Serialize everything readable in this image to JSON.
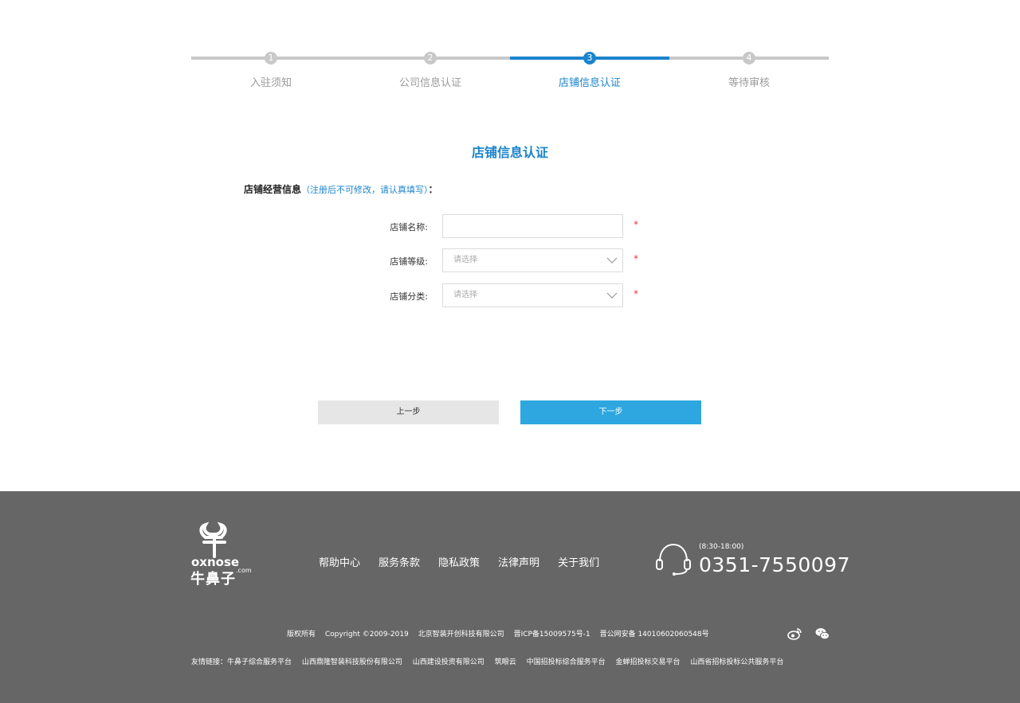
{
  "stepper": {
    "steps": [
      {
        "num": "1",
        "label": "入驻须知"
      },
      {
        "num": "2",
        "label": "公司信息认证"
      },
      {
        "num": "3",
        "label": "店铺信息认证"
      },
      {
        "num": "4",
        "label": "等待审核"
      }
    ],
    "active_step": 3
  },
  "form": {
    "title": "店铺信息认证",
    "section_heading": "店铺经营信息",
    "section_note": "（注册后不可修改，请认真填写）",
    "section_colon": "：",
    "fields": [
      {
        "label": "店铺名称:",
        "value": "",
        "placeholder": "",
        "required_mark": "*"
      },
      {
        "label": "店铺等级:",
        "placeholder": "请选择",
        "required_mark": "*"
      },
      {
        "label": "店铺分类:",
        "placeholder": "请选择",
        "required_mark": "*"
      }
    ],
    "prev_label": "上一步",
    "next_label": "下一步"
  },
  "footer": {
    "logo_text": "oxnose",
    "logo_com": ".com",
    "logo_cn": "牛鼻子",
    "nav": [
      "帮助中心",
      "服务条款",
      "隐私政策",
      "法律声明",
      "关于我们"
    ],
    "service_hours": "(8:30-18:00)",
    "phone": "0351-7550097",
    "copyright": [
      "版权所有",
      "Copyright ©2009-2019",
      "北京智装开创科技有限公司",
      "晋ICP备15009575号-1",
      "晋公网安备 14010602060548号"
    ],
    "social_icons": [
      "weibo-icon",
      "wechat-icon"
    ],
    "friend_links_label": "友情链接：",
    "friend_links": [
      "牛鼻子综合服务平台",
      "山西鼎隆智装科技股份有限公司",
      "山西建设投资有限公司",
      "筑眼云",
      "中国招投标综合服务平台",
      "金蝉招投标交易平台",
      "山西省招标投标公共服务平台"
    ]
  },
  "colors": {
    "accent": "#1b84cc",
    "next_button": "#2ea7e0",
    "footer_bg": "#666666",
    "inactive_step": "#c8c8c8",
    "required": "#e23b3b"
  }
}
